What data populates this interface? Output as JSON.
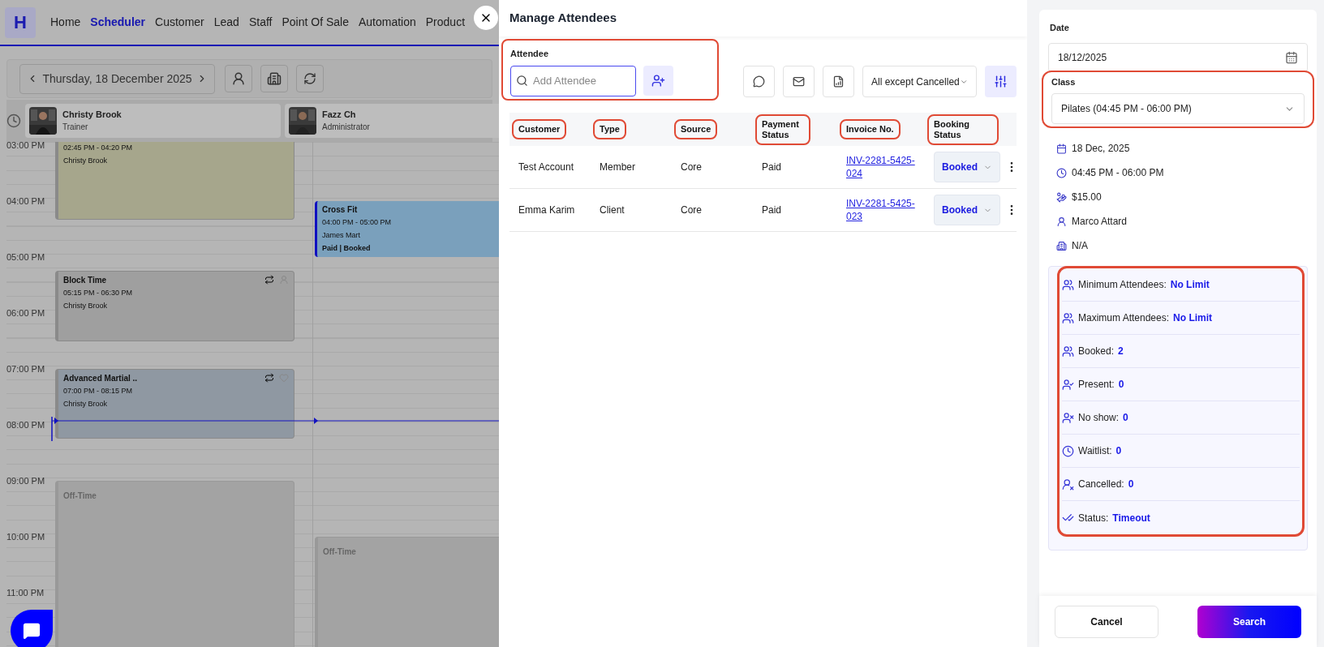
{
  "nav": {
    "logo": "H",
    "items": [
      {
        "label": "Home",
        "selected": false
      },
      {
        "label": "Scheduler",
        "selected": true
      },
      {
        "label": "Customer",
        "selected": false
      },
      {
        "label": "Lead",
        "selected": false
      },
      {
        "label": "Staff",
        "selected": false
      },
      {
        "label": "Point Of Sale",
        "selected": false
      },
      {
        "label": "Automation",
        "selected": false
      },
      {
        "label": "Product",
        "selected": false
      }
    ]
  },
  "calendar": {
    "date": "Thursday, 18 December 2025",
    "current_time_marker": true,
    "hours": [
      "03:00 PM",
      "04:00 PM",
      "05:00 PM",
      "06:00 PM",
      "07:00 PM",
      "08:00 PM",
      "09:00 PM",
      "10:00 PM",
      "11:00 PM"
    ],
    "staff": [
      {
        "name": "Christy Brook",
        "role": "Trainer",
        "events": [
          {
            "kind": "class",
            "color": "#a6a68c",
            "time": "02:45 PM - 04:20 PM",
            "staff": "Christy Brook"
          },
          {
            "kind": "block",
            "color": "#9f9f9f",
            "title": "Block Time",
            "time": "05:15 PM - 06:30 PM",
            "staff": "Christy Brook"
          },
          {
            "kind": "class",
            "color": "#8f98a2",
            "title": "Advanced Martial ..",
            "time": "07:00 PM - 08:15 PM",
            "staff": "Christy Brook"
          },
          {
            "kind": "off",
            "title": "Off-Time"
          }
        ]
      },
      {
        "name": "Fazz Ch",
        "role": "Administrator",
        "events": [
          {
            "kind": "booking",
            "color": "#7aa0bc",
            "title": "Cross Fit",
            "time": "04:00 PM - 05:00 PM",
            "staff": "James Mart",
            "status": "Paid | Booked"
          },
          {
            "kind": "off",
            "title": "Off-Time"
          }
        ]
      }
    ]
  },
  "dialog": {
    "title": "Manage Attendees",
    "attendee": {
      "label": "Attendee",
      "placeholder": "Add Attendee",
      "highlighted": true
    },
    "filter": "All except Cancelled",
    "table": {
      "columns": [
        {
          "label": "Customer",
          "highlighted": true
        },
        {
          "label": "Type",
          "highlighted": true
        },
        {
          "label": "Source",
          "highlighted": true
        },
        {
          "label": "Payment Status",
          "highlighted": true
        },
        {
          "label": "Invoice No.",
          "highlighted": true
        },
        {
          "label": "Booking Status",
          "highlighted": true
        }
      ],
      "rows": [
        {
          "customer": "Test Account",
          "type": "Member",
          "source": "Core",
          "payment": "Paid",
          "invoice": "INV-2281-5425-024",
          "booking": "Booked"
        },
        {
          "customer": "Emma Karim",
          "type": "Client",
          "source": "Core",
          "payment": "Paid",
          "invoice": "INV-2281-5425-023",
          "booking": "Booked"
        }
      ]
    }
  },
  "side": {
    "date_label": "Date",
    "date_value": "18/12/2025",
    "class_label": "Class",
    "class_value": "Pilates (04:45 PM - 06:00 PM)",
    "class_highlighted": true,
    "details": [
      {
        "kind": "date",
        "text": "18 Dec, 2025"
      },
      {
        "kind": "time",
        "text": "04:45 PM - 06:00 PM"
      },
      {
        "kind": "price",
        "text": "$15.00"
      },
      {
        "kind": "instructor",
        "text": "Marco Attard"
      },
      {
        "kind": "room",
        "text": "N/A"
      }
    ],
    "stats_highlighted": true,
    "stats": [
      {
        "kind": "min",
        "label": "Minimum Attendees:",
        "value": "No Limit"
      },
      {
        "kind": "max",
        "label": "Maximum Attendees:",
        "value": "No Limit"
      },
      {
        "kind": "booked",
        "label": "Booked:",
        "value": "2"
      },
      {
        "kind": "present",
        "label": "Present:",
        "value": "0"
      },
      {
        "kind": "noshow",
        "label": "No show:",
        "value": "0"
      },
      {
        "kind": "waitlist",
        "label": "Waitlist:",
        "value": "0"
      },
      {
        "kind": "cancelled",
        "label": "Cancelled:",
        "value": "0"
      },
      {
        "kind": "status",
        "label": "Status:",
        "value": "Timeout"
      }
    ],
    "buttons": {
      "cancel": "Cancel",
      "search": "Search"
    }
  }
}
